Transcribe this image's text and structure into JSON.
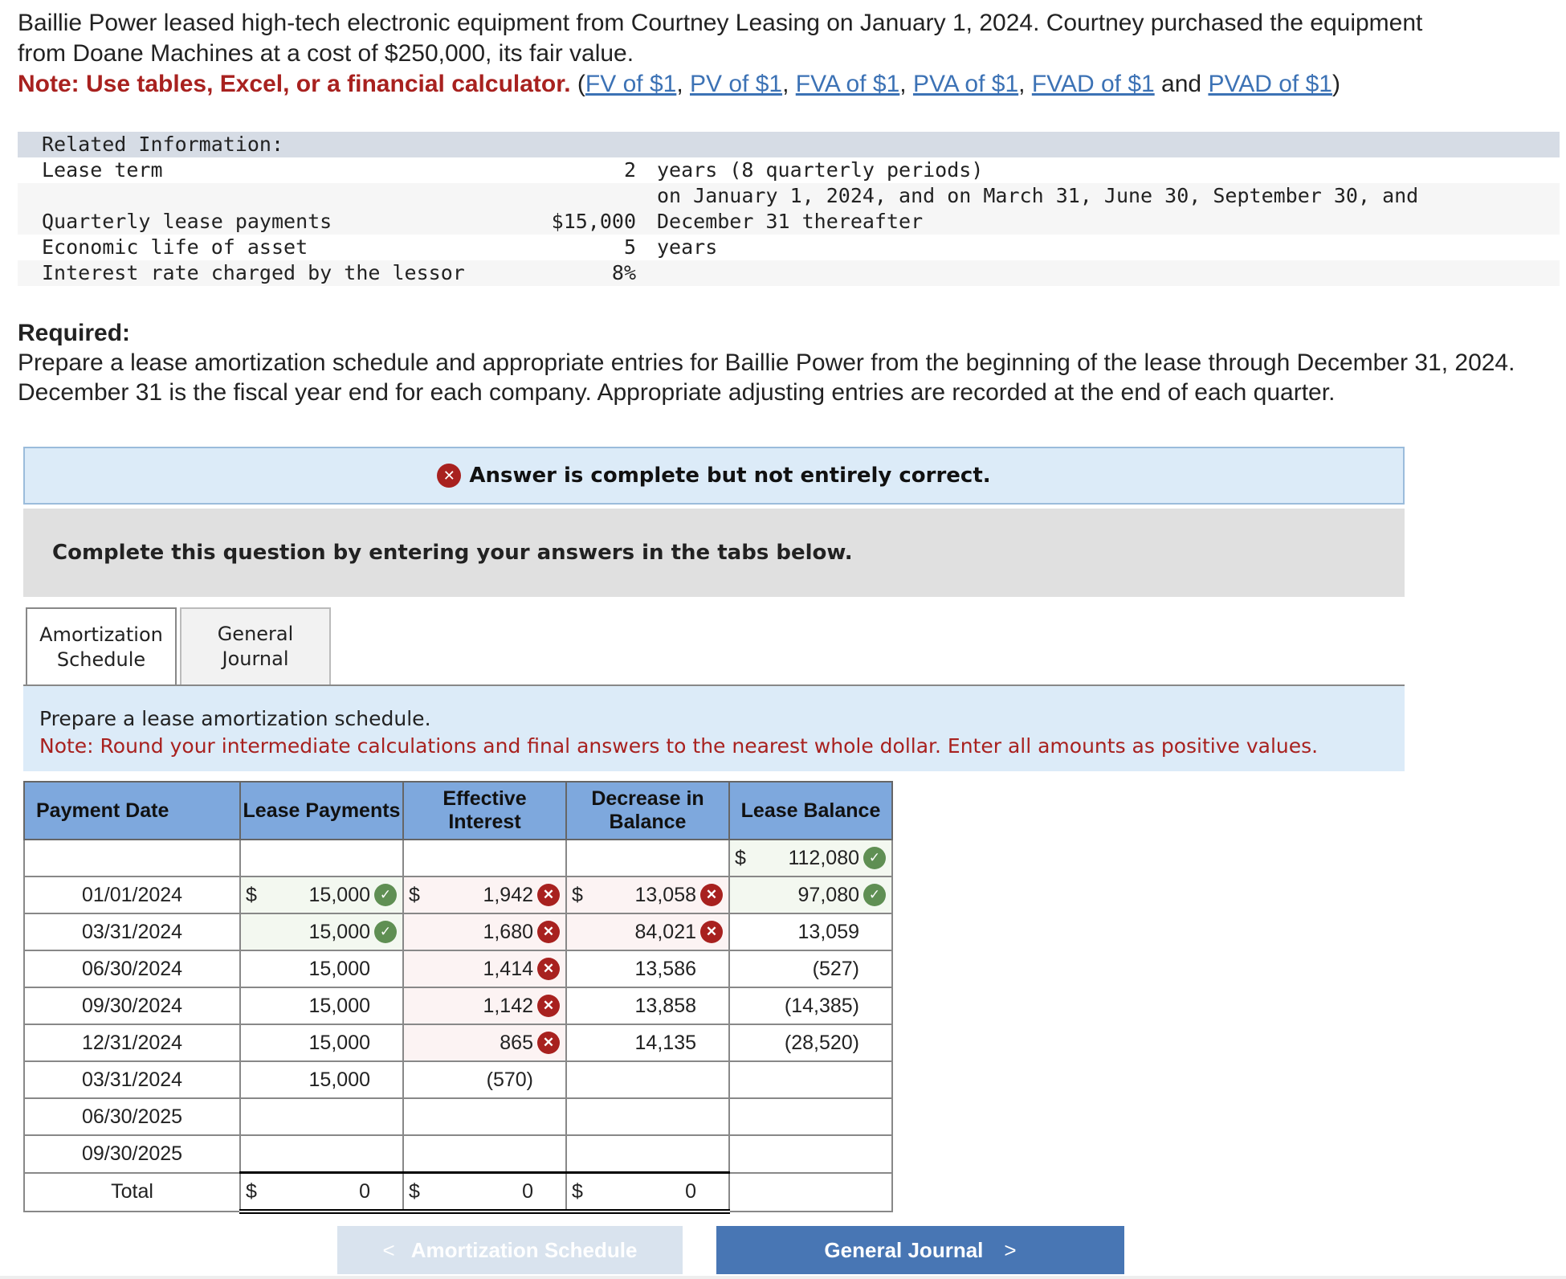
{
  "intro": {
    "line1": "Baillie Power leased high-tech electronic equipment from Courtney Leasing on January 1, 2024. Courtney purchased the equipment",
    "line2": "from Doane Machines at a cost of $250,000, its fair value.",
    "note": "Note: Use tables, Excel, or a financial calculator.",
    "links": [
      "FV of $1",
      "PV of $1",
      "FVA of $1",
      "PVA of $1",
      "FVAD of $1",
      "PVAD of $1"
    ],
    "and": "and"
  },
  "related": {
    "header": "Related Information:",
    "rows": [
      {
        "label": "Lease term",
        "value": "2",
        "text": "years (8 quarterly periods)"
      },
      {
        "label": "",
        "value": "",
        "text": "on January 1, 2024, and on March 31, June 30, September 30, and"
      },
      {
        "label": "Quarterly lease payments",
        "value": "$15,000",
        "text": "December 31 thereafter"
      },
      {
        "label": "Economic life of asset",
        "value": "5",
        "text": "years"
      },
      {
        "label": "Interest rate charged by the lessor",
        "value": "8%",
        "text": ""
      }
    ]
  },
  "required": {
    "title": "Required:",
    "text": "Prepare a lease amortization schedule and appropriate entries for Baillie Power from the beginning of the lease through December 31, 2024. December 31 is the fiscal year end for each company. Appropriate adjusting entries are recorded at the end of each quarter."
  },
  "banner": "Answer is complete but not entirely correct.",
  "complete_prompt": "Complete this question by entering your answers in the tabs below.",
  "tabs": [
    "Amortization Schedule",
    "General Journal"
  ],
  "instructions": {
    "line1": "Prepare a lease amortization schedule.",
    "note": "Note: Round your intermediate calculations and final answers to the nearest whole dollar. Enter all amounts as positive values."
  },
  "table": {
    "headers": [
      "Payment Date",
      "Lease Payments",
      "Effective Interest",
      "Decrease in Balance",
      "Lease Balance"
    ],
    "initial_balance": {
      "value": "112,080",
      "status": "correct"
    },
    "rows": [
      {
        "date": "01/01/2024",
        "pay": "15,000",
        "pay_s": "correct",
        "int": "1,942",
        "int_s": "incorrect",
        "dec": "13,058",
        "dec_s": "incorrect",
        "bal": "97,080",
        "bal_s": "correct"
      },
      {
        "date": "03/31/2024",
        "pay": "15,000",
        "pay_s": "correct",
        "int": "1,680",
        "int_s": "incorrect",
        "dec": "84,021",
        "dec_s": "incorrect",
        "bal": "13,059",
        "bal_s": ""
      },
      {
        "date": "06/30/2024",
        "pay": "15,000",
        "pay_s": "",
        "int": "1,414",
        "int_s": "incorrect",
        "dec": "13,586",
        "dec_s": "",
        "bal": "(527)",
        "bal_s": ""
      },
      {
        "date": "09/30/2024",
        "pay": "15,000",
        "pay_s": "",
        "int": "1,142",
        "int_s": "incorrect",
        "dec": "13,858",
        "dec_s": "",
        "bal": "(14,385)",
        "bal_s": ""
      },
      {
        "date": "12/31/2024",
        "pay": "15,000",
        "pay_s": "",
        "int": "865",
        "int_s": "incorrect",
        "dec": "14,135",
        "dec_s": "",
        "bal": "(28,520)",
        "bal_s": ""
      },
      {
        "date": "03/31/2024",
        "pay": "15,000",
        "pay_s": "",
        "int": "(570)",
        "int_s": "",
        "dec": "",
        "dec_s": "",
        "bal": "",
        "bal_s": ""
      },
      {
        "date": "06/30/2025",
        "pay": "",
        "pay_s": "",
        "int": "",
        "int_s": "",
        "dec": "",
        "dec_s": "",
        "bal": "",
        "bal_s": ""
      },
      {
        "date": "09/30/2025",
        "pay": "",
        "pay_s": "",
        "int": "",
        "int_s": "",
        "dec": "",
        "dec_s": "",
        "bal": "",
        "bal_s": ""
      }
    ],
    "total": {
      "label": "Total",
      "pay": "0",
      "int": "0",
      "dec": "0"
    },
    "currency": "$"
  },
  "nav": {
    "prev": "Amortization Schedule",
    "next": "General Journal"
  },
  "colors": {
    "accent": "#4876b4",
    "error": "#a8211f",
    "success": "#5f8f53",
    "header": "#7ea8dd"
  }
}
